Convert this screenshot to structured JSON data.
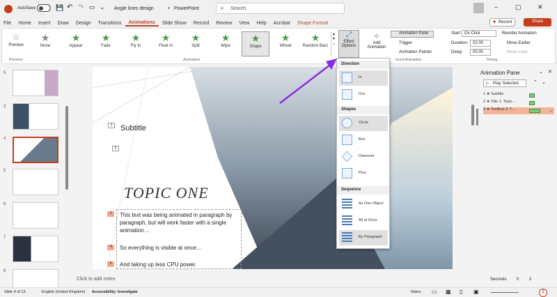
{
  "titlebar": {
    "autosave": "AutoSave",
    "toggle": "Off",
    "doc": "Angle lines design",
    "sep": "•",
    "app": "PowerPoint",
    "search": "Search",
    "record": "Record",
    "share": "Share"
  },
  "tabs": [
    "File",
    "Home",
    "Insert",
    "Draw",
    "Design",
    "Transitions",
    "Animations",
    "Slide Show",
    "Record",
    "Review",
    "View",
    "Help",
    "Acrobat",
    "Shape Format"
  ],
  "ribbon": {
    "preview": "Preview",
    "effects": [
      "None",
      "Appear",
      "Fade",
      "Fly In",
      "Float In",
      "Split",
      "Wipe",
      "Shape",
      "Wheel",
      "Random Bars"
    ],
    "effect_options": [
      "Effect",
      "Options"
    ],
    "add_animation": [
      "Add",
      "Animation"
    ],
    "animation_pane": "Animation Pane",
    "trigger": "Trigger",
    "painter": "Animation Painter",
    "start_label": "Start:",
    "start_value": "On Click",
    "duration_label": "Duration:",
    "duration_value": "02.00",
    "delay_label": "Delay:",
    "delay_value": "00.00",
    "reorder": "Reorder Animation",
    "earlier": "Move Earlier",
    "later": "Move Later",
    "groups": {
      "preview": "Preview",
      "animation": "Animation",
      "advanced": "nced Animation",
      "timing": "Timing"
    }
  },
  "thumbs": [
    "5",
    "3",
    "4",
    "5",
    "6",
    "7",
    "8"
  ],
  "slide": {
    "n1": "1",
    "n2": "2",
    "subtitle": "Subtitle",
    "topic": "TOPIC ONE",
    "n3": "3",
    "text1": "This text was being animated in paragraph by paragraph, but will work faster with a single animation…",
    "n4": "4",
    "text2": "So everything is visible at once…",
    "n5": "5",
    "text3": "And taking up less CPU power."
  },
  "notes": "Click to add notes",
  "dropdown": {
    "direction": "Direction",
    "dir_items": [
      "In",
      "Out"
    ],
    "shapes": "Shapes",
    "shape_items": [
      "Circle",
      "Box",
      "Diamond",
      "Plus"
    ],
    "sequence": "Sequence",
    "seq_items": [
      "As One Object",
      "All at Once",
      "By Paragraph"
    ]
  },
  "animpane": {
    "title": "Animation Pane",
    "play": "Play Selected",
    "items": [
      {
        "n": "1",
        "label": "Subtitle"
      },
      {
        "n": "2",
        "label": "Title 1: Topic…"
      },
      {
        "n": "3",
        "label": "TextBox 3: T…"
      }
    ],
    "seconds": "Seconds",
    "z1": "0",
    "z2": "2"
  },
  "status": {
    "slide": "Slide 4 of 13",
    "lang": "English (United Kingdom)",
    "access": "Accessibility: Investigate",
    "notes": "Notes",
    "zoom": "2"
  }
}
